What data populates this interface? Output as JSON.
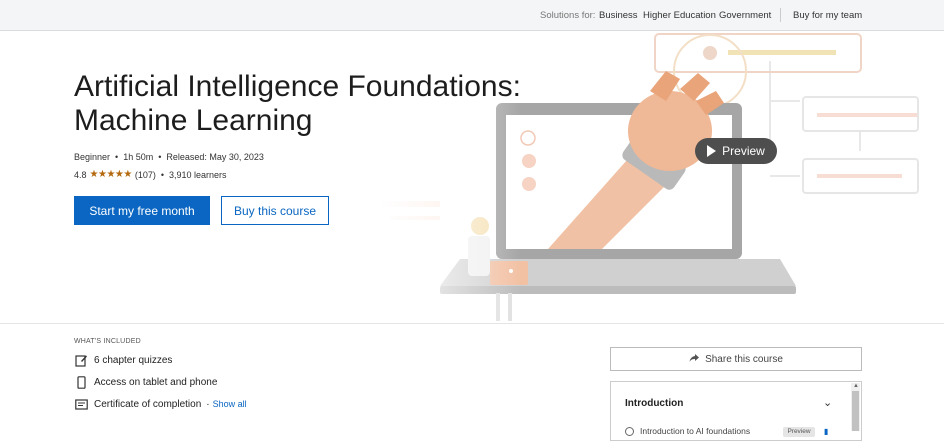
{
  "topbar": {
    "solutions_label": "Solutions for:",
    "links": [
      "Business",
      "Higher Education",
      "Government"
    ],
    "buy_team": "Buy for my team"
  },
  "course": {
    "title_line1": "Artificial Intelligence Foundations:",
    "title_line2": "Machine Learning",
    "level": "Beginner",
    "duration": "1h 50m",
    "released": "Released: May 30, 2023",
    "rating": "4.8",
    "stars": "★★★★★",
    "reviews": "(107)",
    "learners": "3,910 learners"
  },
  "buttons": {
    "start_free": "Start my free month",
    "buy_course": "Buy this course",
    "preview": "Preview"
  },
  "included": {
    "heading": "WHAT'S INCLUDED",
    "items": [
      "6 chapter quizzes",
      "Access on tablet and phone",
      "Certificate of completion"
    ],
    "show_all": "Show all"
  },
  "sidebar": {
    "share": "Share this course",
    "toc_heading": "Introduction",
    "toc_first_item": "Introduction to AI foundations",
    "toc_badge": "Preview"
  },
  "colors": {
    "accent": "#0a66c2",
    "star": "#b4690e",
    "illustration_peach": "#f2c6a8",
    "illustration_orange": "#e9a47a"
  },
  "icons": {
    "quiz": "pencil-square-icon",
    "device": "tablet-icon",
    "certificate": "certificate-icon",
    "share": "share-arrow-icon",
    "play": "play-icon",
    "chevron": "chevron-down-icon",
    "bookmark": "bookmark-icon"
  }
}
